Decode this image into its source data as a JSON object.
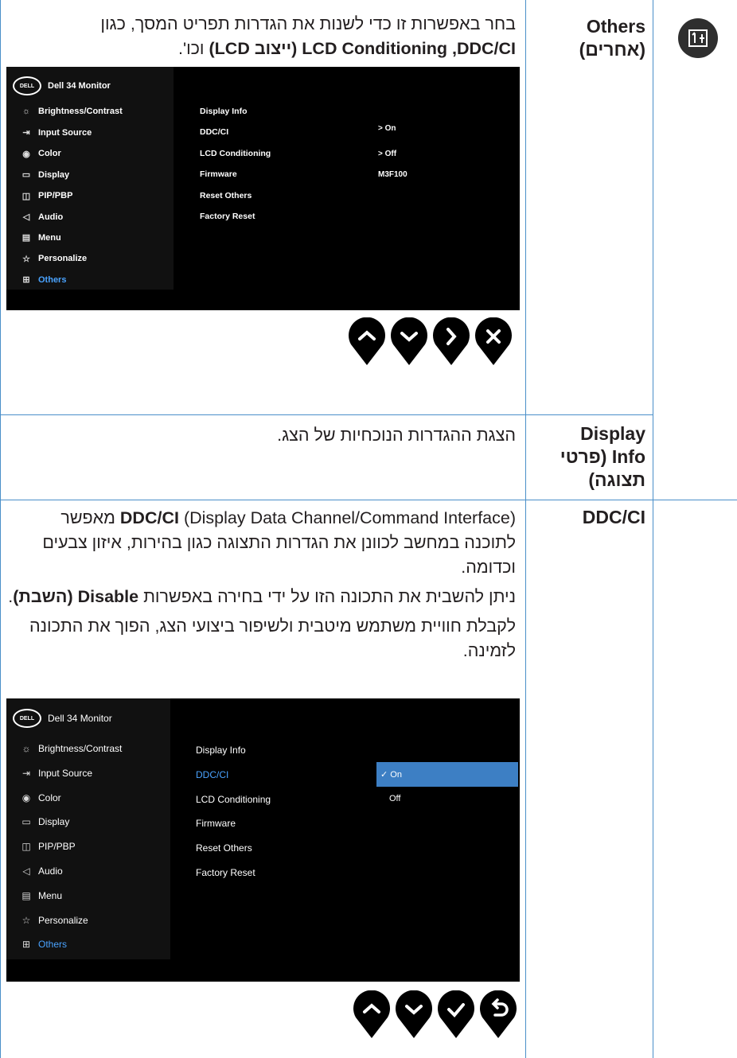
{
  "row1": {
    "term": "Others (אחרים)",
    "desc_html_line1": "בחר באפשרות זו כדי לשנות את הגדרות תפריט המסך, כגון",
    "desc_bold": "LCD Conditioning ,DDC/CI (ייצוב LCD)",
    "desc_tail": " וכו'."
  },
  "osd1": {
    "title": "Dell 34 Monitor",
    "logo": "DELL",
    "menu": [
      "Brightness/Contrast",
      "Input Source",
      "Color",
      "Display",
      "PIP/PBP",
      "Audio",
      "Menu",
      "Personalize",
      "Others"
    ],
    "menu_icons": [
      "brightness-icon",
      "input-source-icon",
      "color-icon",
      "display-icon",
      "pip-pbp-icon",
      "audio-icon",
      "menu-icon",
      "personalize-icon",
      "others-icon"
    ],
    "submenu": [
      "Display Info",
      "DDC/CI",
      "LCD Conditioning",
      "Firmware",
      "Reset Others",
      "Factory Reset"
    ],
    "values": {
      "ddcci": "> On",
      "lcd": "> Off",
      "firmware": "M3F100"
    },
    "buttons": [
      "up-button",
      "down-button",
      "right-button",
      "close-button"
    ]
  },
  "row2": {
    "term": "Display Info (פרטי תצוגה)",
    "desc": "הצגת ההגדרות הנוכחיות של הצג."
  },
  "row3": {
    "term": "DDC/CI",
    "p1_bold": "DDC/CI",
    "p1_rest": " (Display Data Channel/Command Interface) מאפשר לתוכנה במחשב לכוונן את הגדרות התצוגה כגון בהירות, איזון צבעים וכדומה.",
    "p2_start": "ניתן להשבית את התכונה הזו על ידי בחירה באפשרות",
    "p2_bold": "Disable (השבת)",
    "p2_end": ".",
    "p3": "לקבלת חוויית משתמש מיטבית ולשיפור ביצועי הצג, הפוך את התכונה לזמינה."
  },
  "osd2": {
    "title": "Dell 34 Monitor",
    "logo": "DELL",
    "menu": [
      "Brightness/Contrast",
      "Input Source",
      "Color",
      "Display",
      "PIP/PBP",
      "Audio",
      "Menu",
      "Personalize",
      "Others"
    ],
    "submenu": [
      "Display Info",
      "DDC/CI",
      "LCD Conditioning",
      "Firmware",
      "Reset Others",
      "Factory Reset"
    ],
    "options": [
      "✓ On",
      "Off"
    ],
    "buttons": [
      "up-button",
      "down-button",
      "check-button",
      "back-button"
    ]
  },
  "colors": {
    "rule": "#4a8fc9",
    "selected": "#4aa3ff",
    "highlight": "#3d7fc4"
  }
}
